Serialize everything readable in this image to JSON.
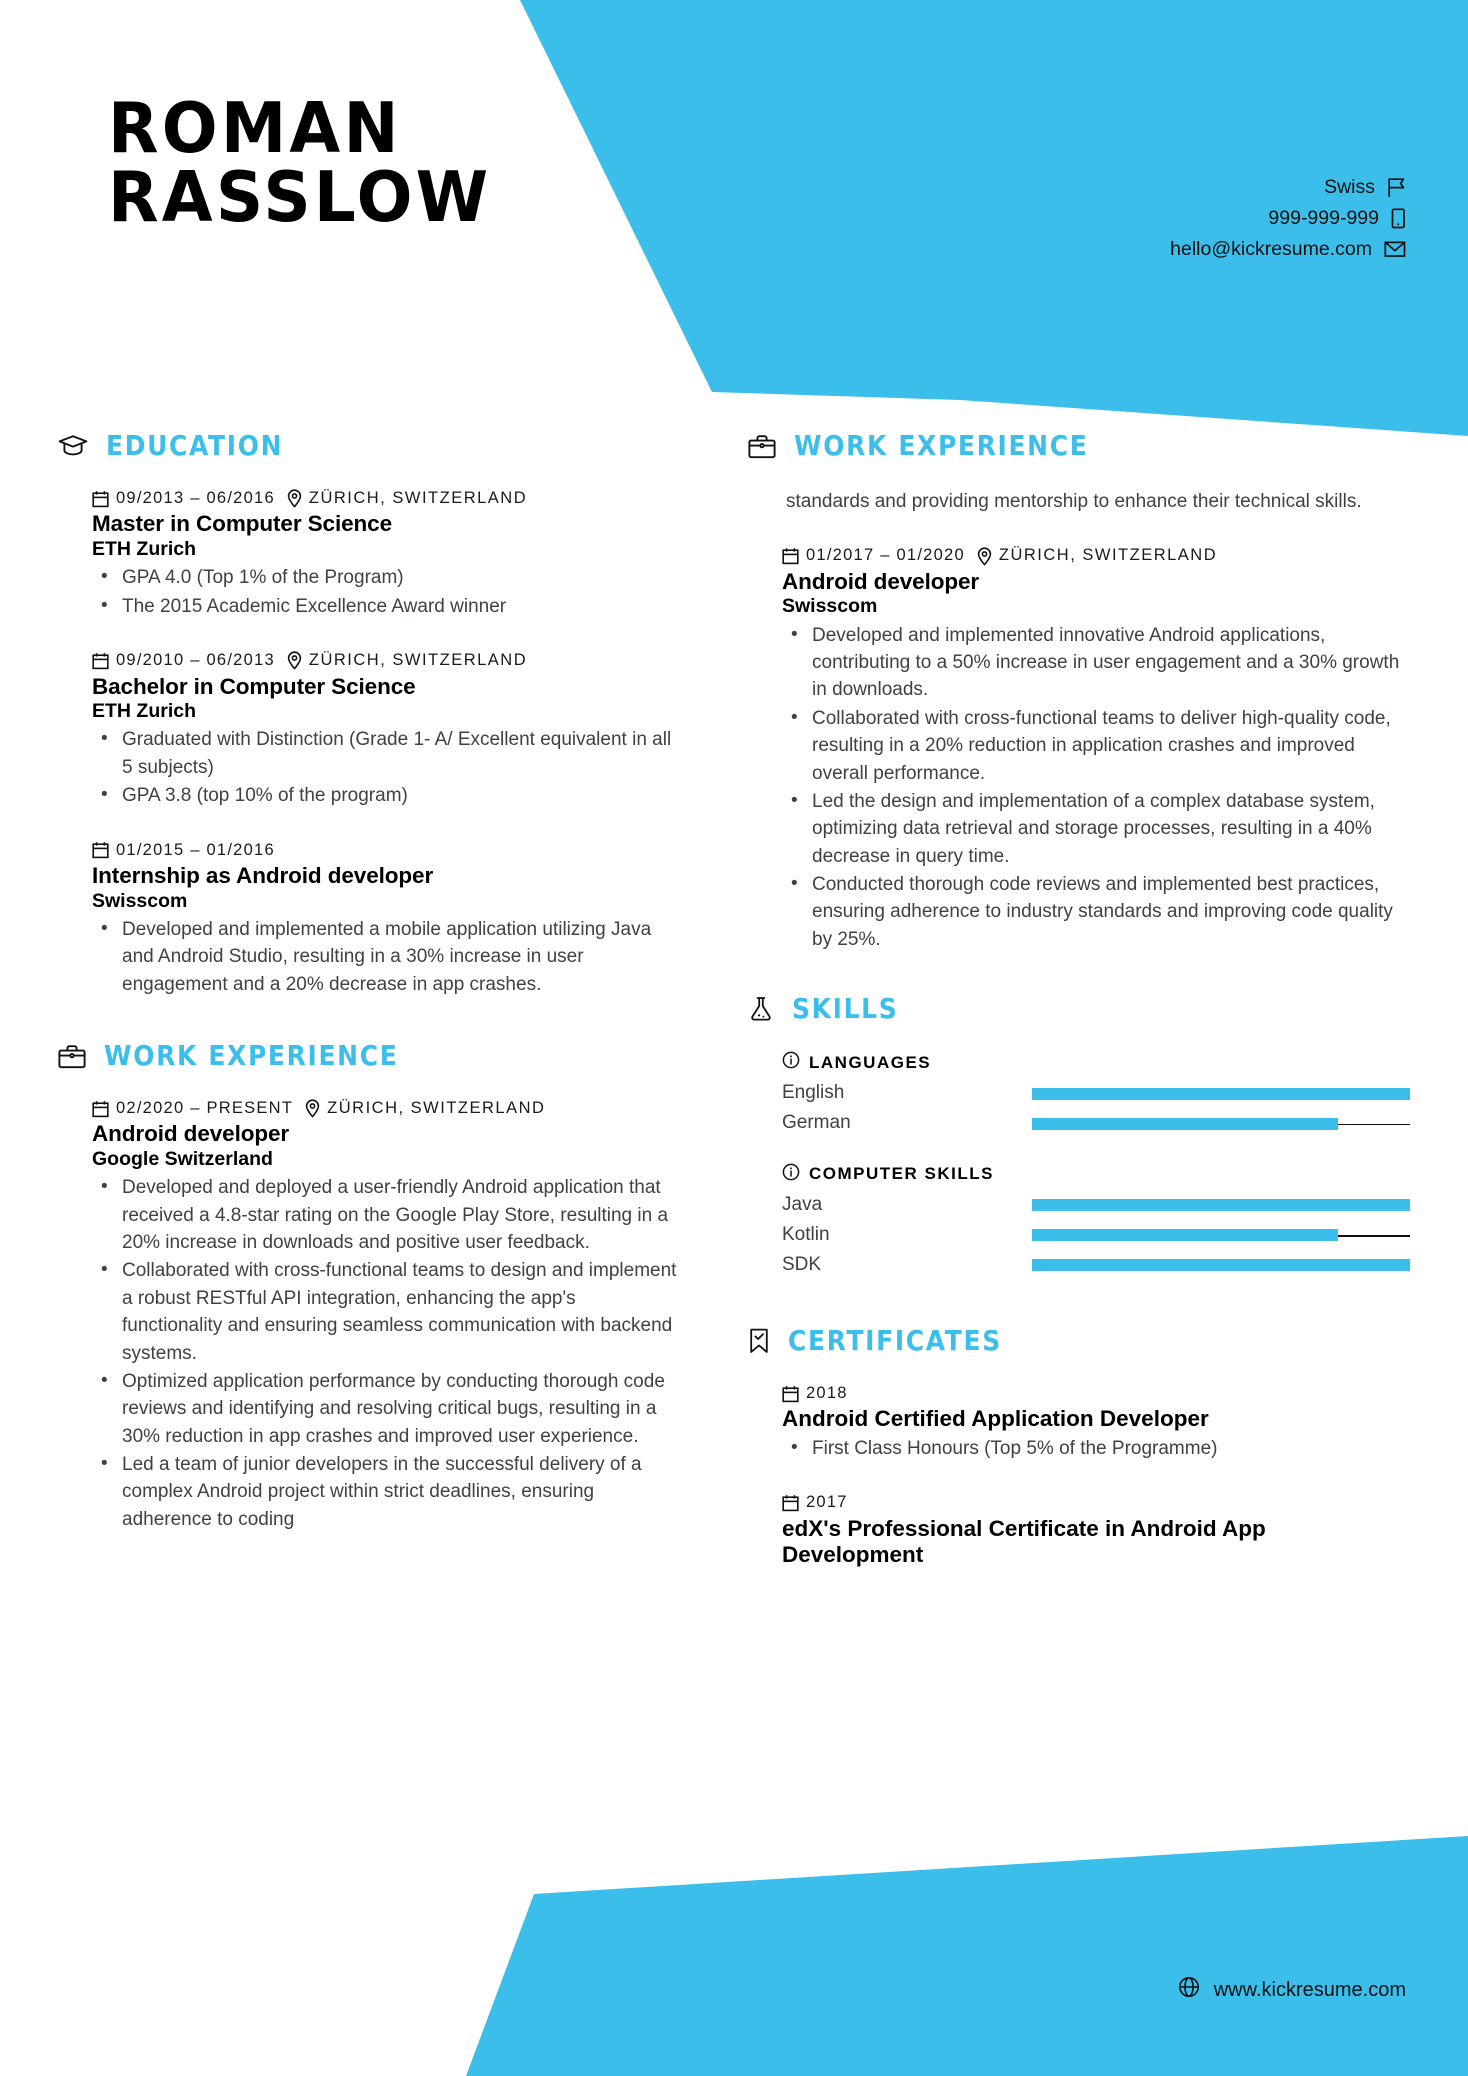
{
  "accent_color": "#3cbeeb",
  "header": {
    "name_line1": "ROMAN",
    "name_line2": "RASSLOW",
    "contacts": [
      {
        "icon": "flag-icon",
        "value": "Swiss"
      },
      {
        "icon": "phone-icon",
        "value": "999-999-999"
      },
      {
        "icon": "email-icon",
        "value": "hello@kickresume.com"
      }
    ]
  },
  "sections": {
    "education": {
      "title": "EDUCATION",
      "icon": "graduation-cap-icon"
    },
    "work_left": {
      "title": "WORK EXPERIENCE",
      "icon": "briefcase-icon"
    },
    "work_right": {
      "title": "WORK EXPERIENCE",
      "icon": "briefcase-icon"
    },
    "skills": {
      "title": "SKILLS",
      "icon": "flask-icon"
    },
    "certificates": {
      "title": "CERTIFICATES",
      "icon": "bookmark-check-icon"
    }
  },
  "education": [
    {
      "dates": "09/2013 – 06/2016",
      "location": "ZÜRICH, SWITZERLAND",
      "title": "Master in Computer Science",
      "org": "ETH Zurich",
      "bullets": [
        "GPA 4.0 (Top 1% of the Program)",
        "The 2015 Academic Excellence Award winner"
      ]
    },
    {
      "dates": "09/2010 – 06/2013",
      "location": "ZÜRICH, SWITZERLAND",
      "title": "Bachelor in Computer Science",
      "org": "ETH Zurich",
      "bullets": [
        "Graduated with Distinction (Grade 1- A/ Excellent equivalent in all 5 subjects)",
        "GPA 3.8 (top 10% of the program)"
      ]
    },
    {
      "dates": "01/2015 – 01/2016",
      "location": "",
      "title": "Internship as Android developer",
      "org": "Swisscom",
      "bullets": [
        "Developed and implemented a mobile application utilizing Java and Android Studio, resulting in a 30% increase in user engagement and a 20% decrease in app crashes."
      ]
    }
  ],
  "work_left": [
    {
      "dates": "02/2020 – PRESENT",
      "location": "ZÜRICH, SWITZERLAND",
      "title": "Android developer",
      "org": "Google Switzerland",
      "bullets": [
        "Developed and deployed a user-friendly Android application that received a 4.8-star rating on the Google Play Store, resulting in a 20% increase in downloads and positive user feedback.",
        "Collaborated with cross-functional teams to design and implement a robust RESTful API integration, enhancing the app's functionality and ensuring seamless communication with backend systems.",
        "Optimized application performance by conducting thorough code reviews and identifying and resolving critical bugs, resulting in a 30% reduction in app crashes and improved user experience.",
        "Led a team of junior developers in the successful delivery of a complex Android project within strict deadlines, ensuring adherence to coding"
      ]
    }
  ],
  "work_right": {
    "continuation": "standards and providing mentorship to enhance their technical skills.",
    "entries": [
      {
        "dates": "01/2017 – 01/2020",
        "location": "ZÜRICH, SWITZERLAND",
        "title": "Android developer",
        "org": "Swisscom",
        "bullets": [
          "Developed and implemented innovative Android applications, contributing to a 50% increase in user engagement and a 30% growth in downloads.",
          "Collaborated with cross-functional teams to deliver high-quality code, resulting in a 20% reduction in application crashes and improved overall performance.",
          "Led the design and implementation of a complex database system, optimizing data retrieval and storage processes, resulting in a 40% decrease in query time.",
          "Conducted thorough code reviews and implemented best practices, ensuring adherence to industry standards and improving code quality by 25%."
        ]
      }
    ]
  },
  "skills": [
    {
      "group": "LANGUAGES",
      "icon": "info-icon",
      "items": [
        {
          "name": "English",
          "level": 100
        },
        {
          "name": "German",
          "level": 81
        }
      ]
    },
    {
      "group": "COMPUTER SKILLS",
      "icon": "info-icon",
      "items": [
        {
          "name": "Java",
          "level": 100
        },
        {
          "name": "Kotlin",
          "level": 81
        },
        {
          "name": "SDK",
          "level": 100
        }
      ]
    }
  ],
  "certificates": [
    {
      "dates": "2018",
      "title": "Android Certified Application Developer",
      "bullets": [
        "First Class Honours (Top 5% of the Programme)"
      ]
    },
    {
      "dates": "2017",
      "title": "edX's Professional Certificate in Android App Development",
      "bullets": []
    }
  ],
  "footer": {
    "icon": "globe-icon",
    "url": "www.kickresume.com"
  }
}
